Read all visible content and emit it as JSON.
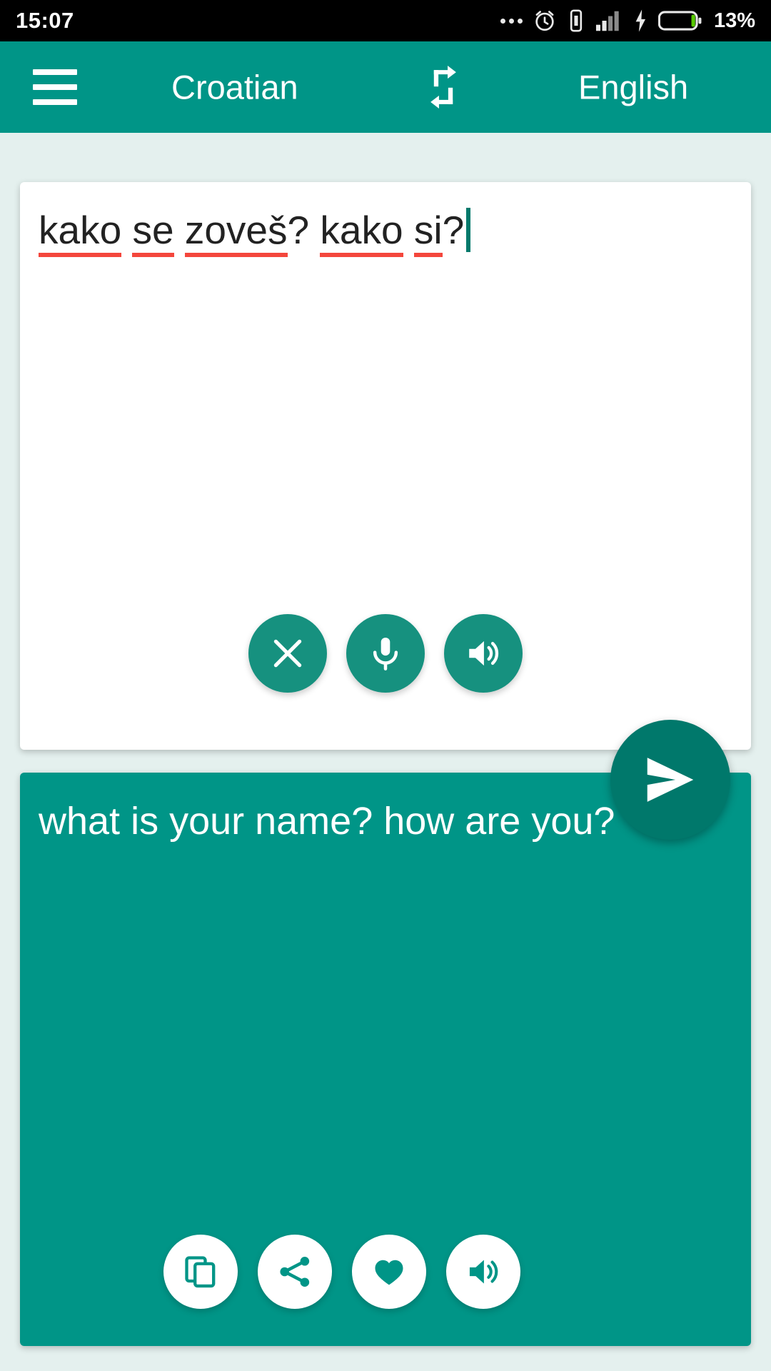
{
  "status_bar": {
    "time": "15:07",
    "battery_percent": "13%",
    "icons": [
      "more-dots-icon",
      "alarm-icon",
      "vibrate-icon",
      "signal-bars-icon",
      "charging-bolt-icon",
      "battery-icon"
    ]
  },
  "app_bar": {
    "menu_label": "menu-icon",
    "source_language": "Croatian",
    "target_language": "English",
    "swap_label": "swap-languages-icon"
  },
  "source": {
    "words": [
      "kako",
      "se",
      "zoveš",
      "kako",
      "si"
    ],
    "text": "kako se zoveš? kako si?",
    "spellcheck_color": "#f4463c",
    "caret_color": "#00796b",
    "actions": [
      {
        "name": "clear",
        "icon": "close-icon"
      },
      {
        "name": "speak",
        "icon": "microphone-icon"
      },
      {
        "name": "listen",
        "icon": "speaker-icon"
      }
    ]
  },
  "send": {
    "label": "send-icon"
  },
  "target": {
    "text": "what is your name? how are you?",
    "actions": [
      {
        "name": "copy",
        "icon": "copy-icon"
      },
      {
        "name": "share",
        "icon": "share-icon"
      },
      {
        "name": "favorite",
        "icon": "heart-icon"
      },
      {
        "name": "listen",
        "icon": "speaker-icon"
      }
    ]
  },
  "colors": {
    "primary": "#009587",
    "primary_dark": "#00786b",
    "fab_teal": "#16917f",
    "background": "#e4f0ee",
    "card": "#ffffff",
    "status_bar": "#000000"
  }
}
